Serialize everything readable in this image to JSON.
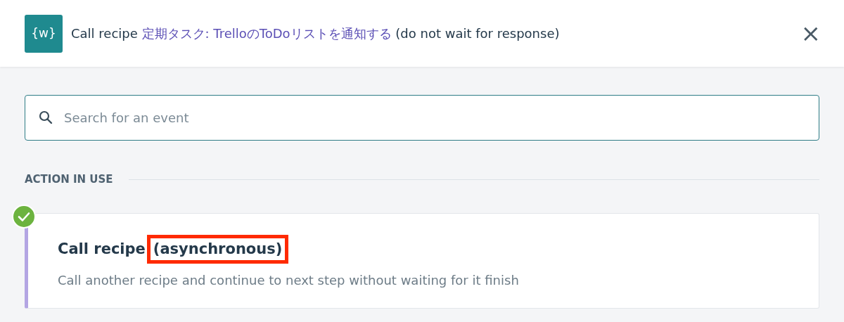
{
  "header": {
    "logo": "{w}",
    "prefix": "Call recipe",
    "recipe_link": "定期タスク: TrelloのToDoリストを通知する",
    "suffix": "(do not wait for response)",
    "close": "×"
  },
  "search": {
    "placeholder": "Search for an event"
  },
  "section": {
    "label": "ACTION IN USE"
  },
  "action": {
    "title": "Call recipe",
    "highlighted": "(asynchronous)",
    "description": "Call another recipe and continue to next step without waiting for it finish",
    "in_use": true
  }
}
